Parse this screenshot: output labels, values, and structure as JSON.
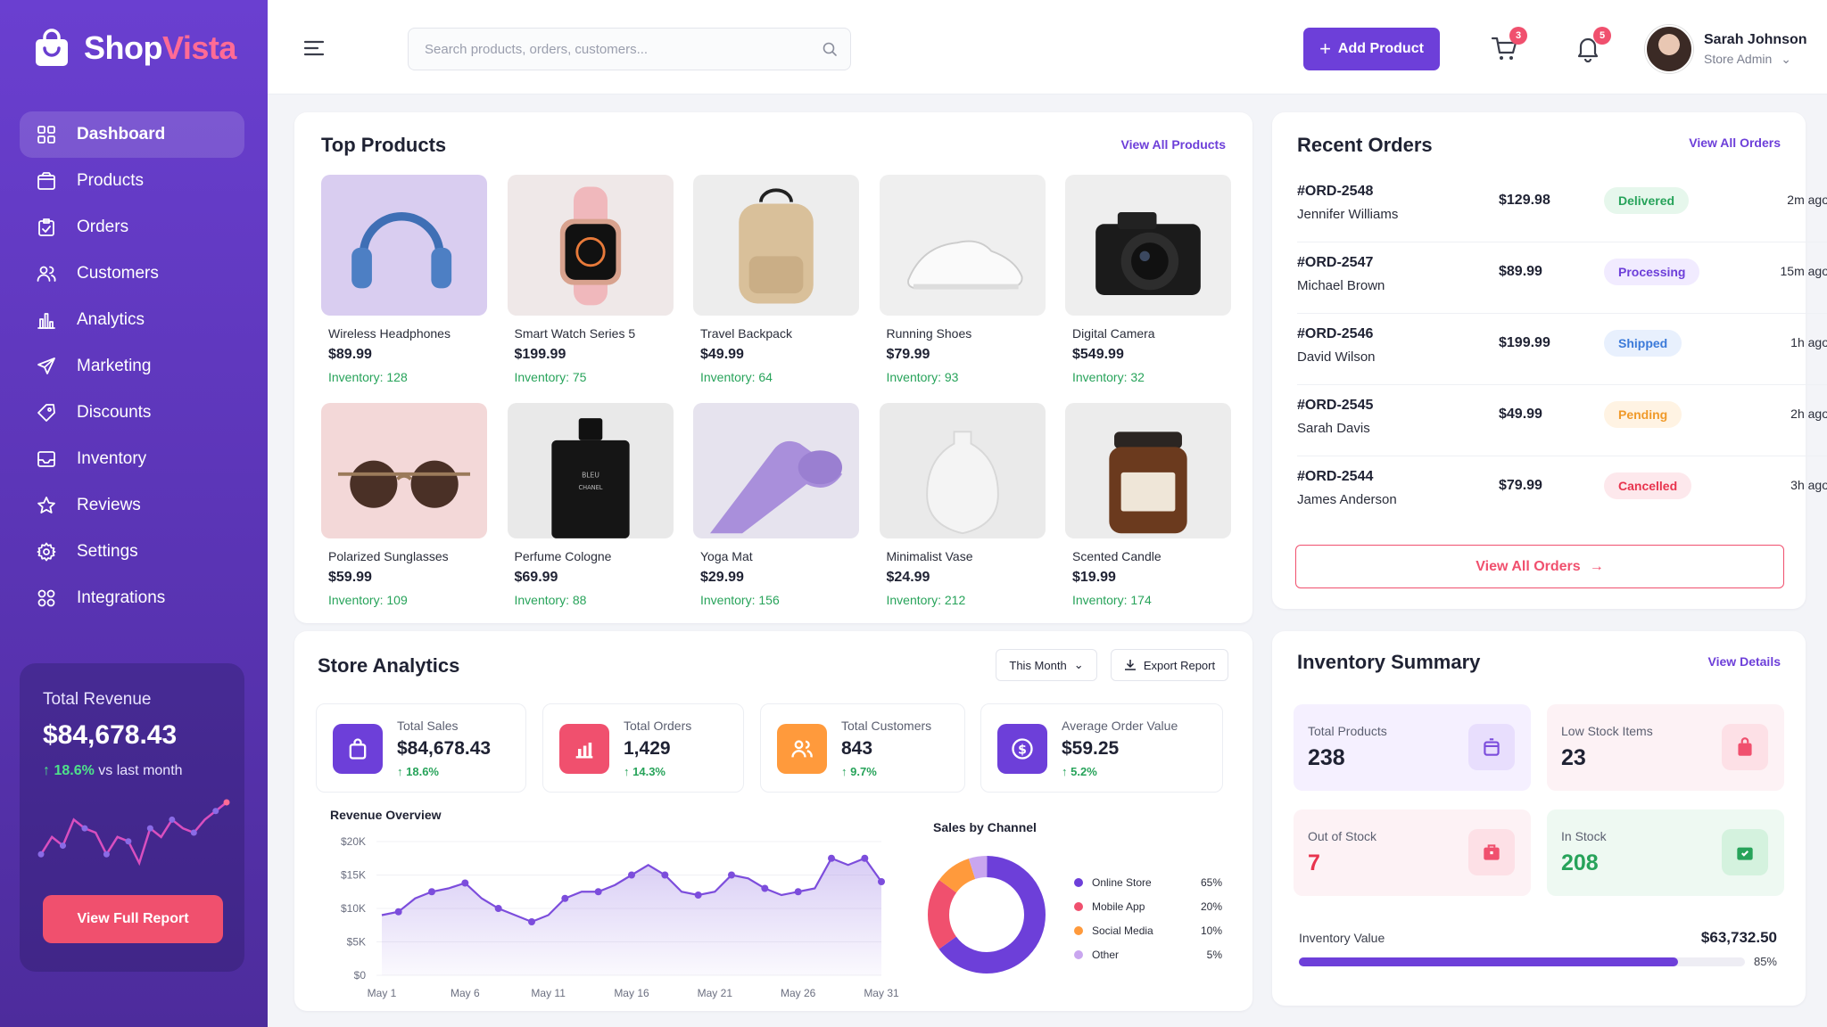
{
  "brand": {
    "part1": "Shop",
    "part2": "Vista"
  },
  "nav": [
    {
      "label": "Dashboard",
      "icon": "grid-icon",
      "active": true
    },
    {
      "label": "Products",
      "icon": "box-icon"
    },
    {
      "label": "Orders",
      "icon": "clipboard-icon"
    },
    {
      "label": "Customers",
      "icon": "users-icon"
    },
    {
      "label": "Analytics",
      "icon": "bar-chart-icon"
    },
    {
      "label": "Marketing",
      "icon": "send-icon"
    },
    {
      "label": "Discounts",
      "icon": "tag-icon"
    },
    {
      "label": "Inventory",
      "icon": "inbox-icon"
    },
    {
      "label": "Reviews",
      "icon": "star-icon"
    },
    {
      "label": "Settings",
      "icon": "gear-icon"
    },
    {
      "label": "Integrations",
      "icon": "apps-icon"
    }
  ],
  "revenue": {
    "label": "Total Revenue",
    "value": "$84,678.43",
    "change": "18.6%",
    "change_suffix": "vs last month",
    "button": "View Full Report",
    "sparkline": [
      3,
      5,
      4,
      7,
      6,
      5.5,
      3,
      5,
      4.5,
      2,
      6,
      5,
      7,
      6,
      5.5,
      7,
      8,
      9
    ]
  },
  "header": {
    "search_placeholder": "Search products, orders, customers...",
    "add_button": "Add Product",
    "cart_count": "3",
    "notif_count": "5",
    "user_name": "Sarah Johnson",
    "user_role": "Store Admin"
  },
  "top_products": {
    "title": "Top Products",
    "link": "View All Products",
    "items": [
      {
        "name": "Wireless Headphones",
        "price": "$89.99",
        "inventory": "Inventory: 128"
      },
      {
        "name": "Smart Watch Series 5",
        "price": "$199.99",
        "inventory": "Inventory: 75"
      },
      {
        "name": "Travel Backpack",
        "price": "$49.99",
        "inventory": "Inventory: 64"
      },
      {
        "name": "Running Shoes",
        "price": "$79.99",
        "inventory": "Inventory: 93"
      },
      {
        "name": "Digital Camera",
        "price": "$549.99",
        "inventory": "Inventory: 32"
      },
      {
        "name": "Polarized Sunglasses",
        "price": "$59.99",
        "inventory": "Inventory: 109"
      },
      {
        "name": "Perfume Cologne",
        "price": "$69.99",
        "inventory": "Inventory: 88"
      },
      {
        "name": "Yoga Mat",
        "price": "$29.99",
        "inventory": "Inventory: 156"
      },
      {
        "name": "Minimalist Vase",
        "price": "$24.99",
        "inventory": "Inventory: 212"
      },
      {
        "name": "Scented Candle",
        "price": "$19.99",
        "inventory": "Inventory: 174"
      }
    ]
  },
  "recent_orders": {
    "title": "Recent Orders",
    "link": "View All Orders",
    "button": "View All Orders",
    "items": [
      {
        "id": "#ORD-2548",
        "customer": "Jennifer Williams",
        "amount": "$129.98",
        "status": "Delivered",
        "time": "2m ago"
      },
      {
        "id": "#ORD-2547",
        "customer": "Michael Brown",
        "amount": "$89.99",
        "status": "Processing",
        "time": "15m ago"
      },
      {
        "id": "#ORD-2546",
        "customer": "David Wilson",
        "amount": "$199.99",
        "status": "Shipped",
        "time": "1h ago"
      },
      {
        "id": "#ORD-2545",
        "customer": "Sarah Davis",
        "amount": "$49.99",
        "status": "Pending",
        "time": "2h ago"
      },
      {
        "id": "#ORD-2544",
        "customer": "James Anderson",
        "amount": "$79.99",
        "status": "Cancelled",
        "time": "3h ago"
      }
    ]
  },
  "analytics": {
    "title": "Store Analytics",
    "period": "This Month",
    "export": "Export Report",
    "stats": [
      {
        "label": "Total Sales",
        "value": "$84,678.43",
        "change": "18.6%",
        "icon": "bag-icon",
        "color": "#6d3fd9"
      },
      {
        "label": "Total Orders",
        "value": "1,429",
        "change": "14.3%",
        "icon": "chart-icon",
        "color": "#f0506e"
      },
      {
        "label": "Total Customers",
        "value": "843",
        "change": "9.7%",
        "icon": "users-icon",
        "color": "#ff9a3c"
      },
      {
        "label": "Average Order Value",
        "value": "$59.25",
        "change": "5.2%",
        "icon": "dollar-icon",
        "color": "#6d3fd9"
      }
    ]
  },
  "chart_data": [
    {
      "type": "area",
      "title": "Revenue Overview",
      "xlabel": "",
      "ylabel": "",
      "x": [
        "May 1",
        "May 2",
        "May 3",
        "May 4",
        "May 5",
        "May 6",
        "May 7",
        "May 8",
        "May 9",
        "May 10",
        "May 11",
        "May 12",
        "May 13",
        "May 14",
        "May 15",
        "May 16",
        "May 17",
        "May 18",
        "May 19",
        "May 20",
        "May 21",
        "May 22",
        "May 23",
        "May 24",
        "May 25",
        "May 26",
        "May 27",
        "May 28",
        "May 29",
        "May 30",
        "May 31"
      ],
      "values": [
        9000,
        9500,
        11500,
        12500,
        13000,
        13800,
        11500,
        10000,
        9000,
        8000,
        9000,
        11500,
        12500,
        12500,
        13500,
        15000,
        16500,
        15000,
        12500,
        12000,
        12500,
        15000,
        14500,
        13000,
        12000,
        12500,
        13000,
        17500,
        16500,
        17500,
        14000
      ],
      "xticks": [
        "May 1",
        "May 6",
        "May 11",
        "May 16",
        "May 21",
        "May 26",
        "May 31"
      ],
      "yticks": [
        "$0",
        "$5K",
        "$10K",
        "$15K",
        "$20K"
      ],
      "ylim": [
        0,
        20000
      ],
      "color": "#7c4ddc"
    },
    {
      "type": "pie",
      "title": "Sales by Channel",
      "categories": [
        "Online Store",
        "Mobile App",
        "Social Media",
        "Other"
      ],
      "values": [
        65,
        20,
        10,
        5
      ],
      "labels": [
        "65%",
        "20%",
        "10%",
        "5%"
      ],
      "colors": [
        "#6d3fd9",
        "#f0506e",
        "#ff9a3c",
        "#c9a6ef"
      ]
    }
  ],
  "inventory": {
    "title": "Inventory Summary",
    "link": "View Details",
    "tiles": [
      {
        "label": "Total Products",
        "value": "238",
        "bg": "#f5f0ff",
        "value_color": "#1f2233",
        "icon_color": "#7c4ddc",
        "icon_bg": "#e8defd"
      },
      {
        "label": "Low Stock Items",
        "value": "23",
        "bg": "#fdf2f5",
        "value_color": "#1f2233",
        "icon_color": "#f0506e",
        "icon_bg": "#fde0e6"
      },
      {
        "label": "Out of Stock",
        "value": "7",
        "bg": "#fdf2f5",
        "value_color": "#e8344e",
        "icon_color": "#f0506e",
        "icon_bg": "#fde0e6"
      },
      {
        "label": "In Stock",
        "value": "208",
        "bg": "#eef9f2",
        "value_color": "#27a35a",
        "icon_color": "#27a35a",
        "icon_bg": "#d4f2de"
      }
    ],
    "value_label": "Inventory Value",
    "value": "$63,732.50",
    "percent_label": "85%",
    "percent": 0.85
  }
}
